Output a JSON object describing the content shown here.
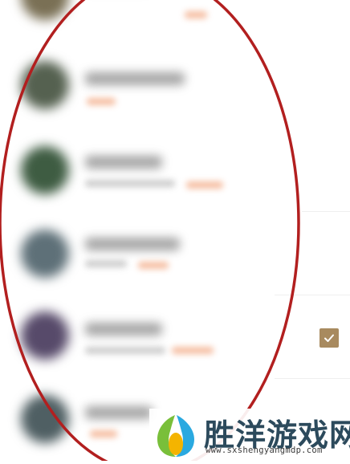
{
  "contacts": [
    {
      "avatar_color": "#7a7055"
    },
    {
      "avatar_color": "#556150"
    },
    {
      "avatar_color": "#3e5c42"
    },
    {
      "avatar_color": "#5e7078"
    },
    {
      "avatar_color": "#574a6a"
    },
    {
      "avatar_color": "#4f5f63"
    }
  ],
  "selection": {
    "checked": true,
    "accent_color": "#a88a5f",
    "icon": "checkmark-icon"
  },
  "annotation": {
    "shape": "ellipse",
    "color": "#b21f1f"
  },
  "watermark": {
    "title": "胜洋游戏网",
    "url": "www.sxshengyangmdp.com",
    "logo_colors": [
      "#79bf3a",
      "#f4b400",
      "#2aa9e0"
    ]
  }
}
